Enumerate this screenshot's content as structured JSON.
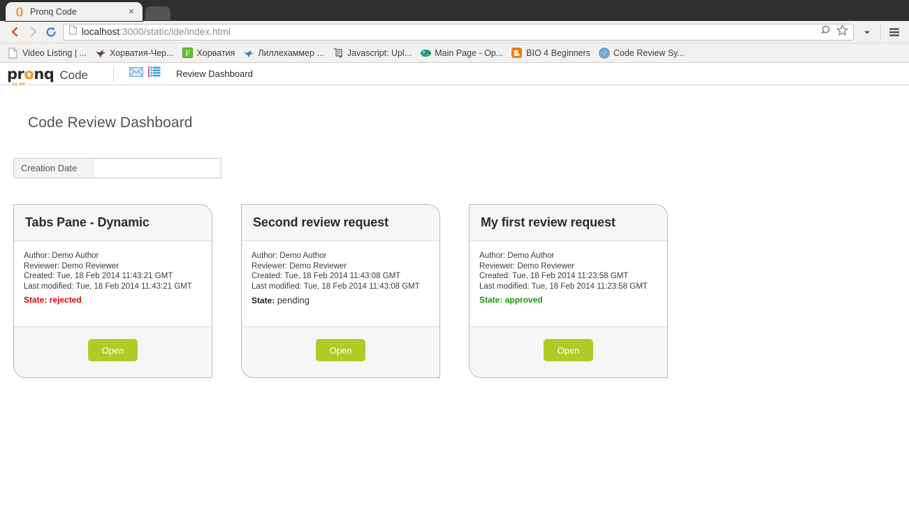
{
  "browser": {
    "tab": {
      "title": "Pronq Code",
      "favicon": "brackets-icon",
      "close": "×"
    },
    "new_tab_label": "",
    "nav": {
      "back_icon": "back-arrow-icon",
      "forward_icon": "forward-arrow-icon",
      "reload_icon": "reload-icon",
      "page_icon": "page-icon",
      "url_host": "localhost",
      "url_rest": ":3000/static/ide/index.html",
      "search_icon": "search-icon",
      "star_icon": "star-icon",
      "dropdown_icon": "chevron-down-icon",
      "menu_icon": "hamburger-menu-icon"
    },
    "bookmarks": [
      {
        "label": "Video Listing | ...",
        "icon": "page-icon"
      },
      {
        "label": "Хорватия-Чер...",
        "icon": "bird-icon"
      },
      {
        "label": "Хорватия",
        "icon": "green-f-icon"
      },
      {
        "label": "Лиллехаммер ...",
        "icon": "bird-icon"
      },
      {
        "label": "Javascript: Upl...",
        "icon": "scroll-icon"
      },
      {
        "label": "Main Page - Op...",
        "icon": "globe-icon"
      },
      {
        "label": "BIO 4 Beginners",
        "icon": "blogger-icon"
      },
      {
        "label": "Code Review Sy...",
        "icon": "spiral-icon"
      }
    ]
  },
  "app": {
    "brand": {
      "logo_p": "p",
      "logo_r": "r",
      "logo_o": "o",
      "logo_n": "n",
      "logo_q": "q",
      "logo_sub": "by HP",
      "code": "Code"
    },
    "nav_icons": [
      {
        "name": "envelope-icon"
      },
      {
        "name": "list-icon"
      }
    ],
    "nav_link": "Review Dashboard",
    "page_title": "Code Review Dashboard",
    "filter": {
      "label": "Creation Date",
      "value": "",
      "placeholder": ""
    },
    "colors": {
      "accent_green": "#b3ca26",
      "brand_orange": "#f49c22",
      "rejected": "#e8000d",
      "approved": "#139b0e"
    },
    "cards": [
      {
        "title": "Tabs Pane - Dynamic",
        "author": "Author: Demo Author",
        "reviewer": "Reviewer: Demo Reviewer",
        "created": "Created: Tue, 18 Feb 2014 11:43:21 GMT",
        "modified": "Last modified: Tue, 18 Feb 2014 11:43:21 GMT",
        "state_label": "State:",
        "state_value": "rejected",
        "state_class": "rejected",
        "button": "Open"
      },
      {
        "title": "Second review request",
        "author": "Author: Demo Author",
        "reviewer": "Reviewer: Demo Reviewer",
        "created": "Created: Tue, 18 Feb 2014 11:43:08 GMT",
        "modified": "Last modified: Tue, 18 Feb 2014 11:43:08 GMT",
        "state_label": "State:",
        "state_value": "pending",
        "state_class": "pending",
        "button": "Open"
      },
      {
        "title": "My first review request",
        "author": "Author: Demo Author",
        "reviewer": "Reviewer: Demo Reviewer",
        "created": "Created: Tue, 18 Feb 2014 11:23:58 GMT",
        "modified": "Last modified: Tue, 18 Feb 2014 11:23:58 GMT",
        "state_label": "State:",
        "state_value": "approved",
        "state_class": "approved",
        "button": "Open"
      }
    ]
  }
}
